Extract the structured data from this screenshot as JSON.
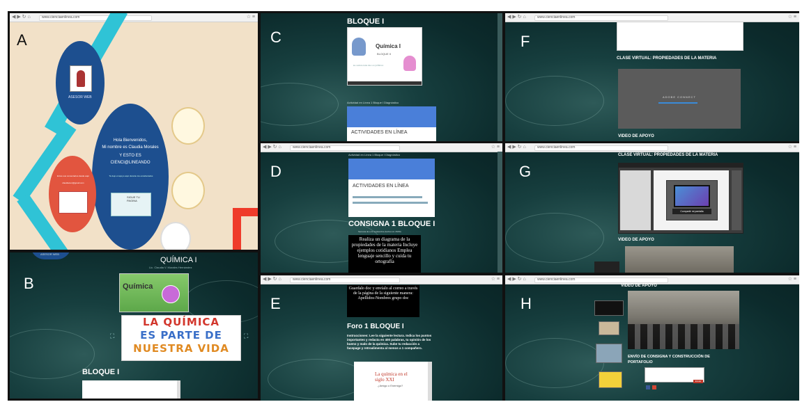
{
  "panels": {
    "a": {
      "letter": "A",
      "url": "www.cienciaenlinea.com",
      "title_line1": "Hola Bienvenidos,",
      "title_line2": "Mi nombre es Claudia Morales",
      "title_line3": "Y ESTO ES",
      "title_line4": "CIENCI@LINEANDO",
      "subtitle": "Te dejo el apoyo aquí durante los encabezados",
      "profile_label": "ASESOR WEB",
      "contact_title": "Envíe sus comentarios desde aquí",
      "contact_email": "claudiamor@gmail.com",
      "bubble_text": "SIGUE TU PAGINA"
    },
    "b": {
      "letter": "B",
      "header": "QUÍMICA I",
      "sub": "Lic. Claudia V. Morales Hernández",
      "quimica_label": "Química",
      "banner_line1": "LA QUÍMICA",
      "banner_line2": "ES PARTE DE",
      "banner_line3": "NUESTRA VIDA",
      "bloque": "BLOQUE I",
      "footer_text": "ASESOR WEB"
    },
    "c": {
      "letter": "C",
      "bloque": "BLOQUE I",
      "slide_title": "Química I",
      "slide_sub": "BLOQUE II",
      "slide_caption": "EL LENGUAJE DE LA QUÍMICA",
      "activity_caption": "Actividad en Línea 1 Bloque I Diagnóstico",
      "card_label": "ACTIVIDADES EN LÍNEA"
    },
    "d": {
      "letter": "D",
      "url": "www.cienciaenlinea.com",
      "top_caption": "Actividad en Línea 1 Bloque I Diagnóstico",
      "card_label": "ACTIVIDADES EN LÍNEA",
      "consigna": "CONSIGNA 1 BLOQUE I",
      "consigna_date": "Semana de a 11 septiembre (fecha Lim 15/09)",
      "box_text": "Realiza un diagrama de la propiedades de la materia Incluye ejemplos cotidianos Emplea lenguaje sencillo y cuida tu ortografía"
    },
    "e": {
      "letter": "E",
      "url": "www.cienciaenlinea.com",
      "box_text": "Guardalo doc y envíalo al correo a través de la página de la siguiente manera: Apellidos-Nombres grupo doc",
      "foro": "Foro 1 BLOQUE I",
      "instructions": "Instrucciones: Lee la siguiente lectura. Indica los puntos importantes y redacta en 400 palabras, tu opinión de los bueno y malo de la química. Sube tu redacción a facepage y retroalimenta al menos a 1 compañero.",
      "doc_title": "La química en el siglo XXI",
      "doc_sub": "¿Amigo o Enemigo?"
    },
    "f": {
      "letter": "F",
      "url": "www.cienciaenlinea.com",
      "clase": "CLASE VIRTUAL:  PROPIEDADES  DE LA MATERIA",
      "connect": "ADOBE CONNECT",
      "video": "VIDEO DE APOYO"
    },
    "g": {
      "letter": "G",
      "url": "www.cienciaenlinea.com",
      "clase": "CLASE VIRTUAL:  PROPIEDADES  DE LA MATERIA",
      "video": "VIDEO DE APOYO",
      "dialog_btn": "Compartir mi pantalla"
    },
    "h": {
      "letter": "H",
      "url": "www.cienciaenlinea.com",
      "video": "VIDEO DE APOYO",
      "envio_line1": "ENVÍO DE CONSIGNA Y CONSTRUCCIÓN DE",
      "envio_line2": "PORTAFOLIO",
      "submit": "Enviar"
    }
  },
  "colors": {
    "teal_dark": "#0c2b2c",
    "beige": "#f2e1c8",
    "navy": "#1d4f8f",
    "coral": "#e2553f",
    "cyan": "#2fc3d6"
  }
}
